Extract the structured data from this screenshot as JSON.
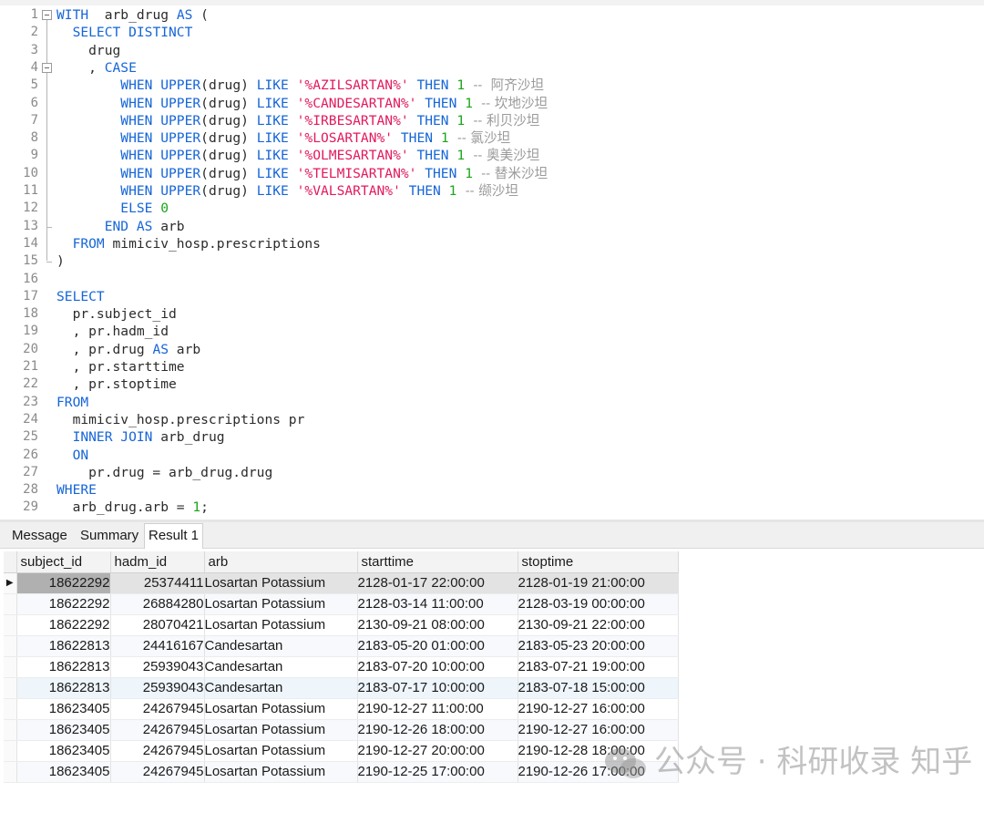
{
  "editor": {
    "lines": [
      {
        "n": "1",
        "segs": [
          [
            "kw",
            "WITH"
          ],
          [
            "",
            "  arb_drug "
          ],
          [
            "kw",
            "AS"
          ],
          [
            "",
            " ("
          ]
        ]
      },
      {
        "n": "2",
        "segs": [
          [
            "",
            "  "
          ],
          [
            "kw",
            "SELECT DISTINCT"
          ]
        ]
      },
      {
        "n": "3",
        "segs": [
          [
            "",
            "    drug"
          ]
        ]
      },
      {
        "n": "4",
        "segs": [
          [
            "",
            "    , "
          ],
          [
            "kw",
            "CASE"
          ]
        ]
      },
      {
        "n": "5",
        "segs": [
          [
            "",
            "        "
          ],
          [
            "kw",
            "WHEN UPPER"
          ],
          [
            "",
            "(drug) "
          ],
          [
            "kw",
            "LIKE"
          ],
          [
            "",
            " "
          ],
          [
            "str",
            "'%AZILSARTAN%'"
          ],
          [
            "",
            " "
          ],
          [
            "kw",
            "THEN"
          ],
          [
            "",
            " "
          ],
          [
            "num",
            "1"
          ],
          [
            "cmt",
            "  --  阿齐沙坦"
          ]
        ]
      },
      {
        "n": "6",
        "segs": [
          [
            "",
            "        "
          ],
          [
            "kw",
            "WHEN UPPER"
          ],
          [
            "",
            "(drug) "
          ],
          [
            "kw",
            "LIKE"
          ],
          [
            "",
            " "
          ],
          [
            "str",
            "'%CANDESARTAN%'"
          ],
          [
            "",
            " "
          ],
          [
            "kw",
            "THEN"
          ],
          [
            "",
            " "
          ],
          [
            "num",
            "1"
          ],
          [
            "cmt",
            "  -- 坎地沙坦"
          ]
        ]
      },
      {
        "n": "7",
        "segs": [
          [
            "",
            "        "
          ],
          [
            "kw",
            "WHEN UPPER"
          ],
          [
            "",
            "(drug) "
          ],
          [
            "kw",
            "LIKE"
          ],
          [
            "",
            " "
          ],
          [
            "str",
            "'%IRBESARTAN%'"
          ],
          [
            "",
            " "
          ],
          [
            "kw",
            "THEN"
          ],
          [
            "",
            " "
          ],
          [
            "num",
            "1"
          ],
          [
            "cmt",
            "  -- 利贝沙坦"
          ]
        ]
      },
      {
        "n": "8",
        "segs": [
          [
            "",
            "        "
          ],
          [
            "kw",
            "WHEN UPPER"
          ],
          [
            "",
            "(drug) "
          ],
          [
            "kw",
            "LIKE"
          ],
          [
            "",
            " "
          ],
          [
            "str",
            "'%LOSARTAN%'"
          ],
          [
            "",
            " "
          ],
          [
            "kw",
            "THEN"
          ],
          [
            "",
            " "
          ],
          [
            "num",
            "1"
          ],
          [
            "cmt",
            "  -- 氯沙坦"
          ]
        ]
      },
      {
        "n": "9",
        "segs": [
          [
            "",
            "        "
          ],
          [
            "kw",
            "WHEN UPPER"
          ],
          [
            "",
            "(drug) "
          ],
          [
            "kw",
            "LIKE"
          ],
          [
            "",
            " "
          ],
          [
            "str",
            "'%OLMESARTAN%'"
          ],
          [
            "",
            " "
          ],
          [
            "kw",
            "THEN"
          ],
          [
            "",
            " "
          ],
          [
            "num",
            "1"
          ],
          [
            "cmt",
            "  -- 奥美沙坦"
          ]
        ]
      },
      {
        "n": "10",
        "segs": [
          [
            "",
            "        "
          ],
          [
            "kw",
            "WHEN UPPER"
          ],
          [
            "",
            "(drug) "
          ],
          [
            "kw",
            "LIKE"
          ],
          [
            "",
            " "
          ],
          [
            "str",
            "'%TELMISARTAN%'"
          ],
          [
            "",
            " "
          ],
          [
            "kw",
            "THEN"
          ],
          [
            "",
            " "
          ],
          [
            "num",
            "1"
          ],
          [
            "cmt",
            "  -- 替米沙坦"
          ]
        ]
      },
      {
        "n": "11",
        "segs": [
          [
            "",
            "        "
          ],
          [
            "kw",
            "WHEN UPPER"
          ],
          [
            "",
            "(drug) "
          ],
          [
            "kw",
            "LIKE"
          ],
          [
            "",
            " "
          ],
          [
            "str",
            "'%VALSARTAN%'"
          ],
          [
            "",
            " "
          ],
          [
            "kw",
            "THEN"
          ],
          [
            "",
            " "
          ],
          [
            "num",
            "1"
          ],
          [
            "cmt",
            "  -- 缬沙坦"
          ]
        ]
      },
      {
        "n": "12",
        "segs": [
          [
            "",
            "        "
          ],
          [
            "kw",
            "ELSE"
          ],
          [
            "",
            " "
          ],
          [
            "num",
            "0"
          ]
        ]
      },
      {
        "n": "13",
        "segs": [
          [
            "",
            "      "
          ],
          [
            "kw",
            "END AS"
          ],
          [
            "",
            " arb"
          ]
        ]
      },
      {
        "n": "14",
        "segs": [
          [
            "",
            "  "
          ],
          [
            "kw",
            "FROM"
          ],
          [
            "",
            " mimiciv_hosp.prescriptions"
          ]
        ]
      },
      {
        "n": "15",
        "segs": [
          [
            "",
            ")"
          ]
        ]
      },
      {
        "n": "16",
        "segs": []
      },
      {
        "n": "17",
        "segs": [
          [
            "kw",
            "SELECT"
          ]
        ]
      },
      {
        "n": "18",
        "segs": [
          [
            "",
            "  pr.subject_id"
          ]
        ]
      },
      {
        "n": "19",
        "segs": [
          [
            "",
            "  , pr.hadm_id"
          ]
        ]
      },
      {
        "n": "20",
        "segs": [
          [
            "",
            "  , pr.drug "
          ],
          [
            "kw",
            "AS"
          ],
          [
            "",
            " arb"
          ]
        ]
      },
      {
        "n": "21",
        "segs": [
          [
            "",
            "  , pr.starttime"
          ]
        ]
      },
      {
        "n": "22",
        "segs": [
          [
            "",
            "  , pr.stoptime"
          ]
        ]
      },
      {
        "n": "23",
        "segs": [
          [
            "kw",
            "FROM"
          ]
        ]
      },
      {
        "n": "24",
        "segs": [
          [
            "",
            "  mimiciv_hosp.prescriptions pr"
          ]
        ]
      },
      {
        "n": "25",
        "segs": [
          [
            "",
            "  "
          ],
          [
            "kw",
            "INNER JOIN"
          ],
          [
            "",
            " arb_drug"
          ]
        ]
      },
      {
        "n": "26",
        "segs": [
          [
            "",
            "  "
          ],
          [
            "kw",
            "ON"
          ]
        ]
      },
      {
        "n": "27",
        "segs": [
          [
            "",
            "    pr.drug = arb_drug.drug"
          ]
        ]
      },
      {
        "n": "28",
        "segs": [
          [
            "kw",
            "WHERE"
          ]
        ]
      },
      {
        "n": "29",
        "segs": [
          [
            "",
            "  arb_drug.arb = "
          ],
          [
            "num",
            "1"
          ],
          [
            "",
            ";"
          ]
        ]
      }
    ]
  },
  "tabs": [
    {
      "label": "Message",
      "active": false
    },
    {
      "label": "Summary",
      "active": false
    },
    {
      "label": "Result 1",
      "active": true
    }
  ],
  "grid": {
    "columns": [
      "subject_id",
      "hadm_id",
      "arb",
      "starttime",
      "stoptime"
    ],
    "rows": [
      [
        "18622292",
        "25374411",
        "Losartan Potassium",
        "2128-01-17 22:00:00",
        "2128-01-19 21:00:00"
      ],
      [
        "18622292",
        "26884280",
        "Losartan Potassium",
        "2128-03-14 11:00:00",
        "2128-03-19 00:00:00"
      ],
      [
        "18622292",
        "28070421",
        "Losartan Potassium",
        "2130-09-21 08:00:00",
        "2130-09-21 22:00:00"
      ],
      [
        "18622813",
        "24416167",
        "Candesartan",
        "2183-05-20 01:00:00",
        "2183-05-23 20:00:00"
      ],
      [
        "18622813",
        "25939043",
        "Candesartan",
        "2183-07-20 10:00:00",
        "2183-07-21 19:00:00"
      ],
      [
        "18622813",
        "25939043",
        "Candesartan",
        "2183-07-17 10:00:00",
        "2183-07-18 15:00:00"
      ],
      [
        "18623405",
        "24267945",
        "Losartan Potassium",
        "2190-12-27 11:00:00",
        "2190-12-27 16:00:00"
      ],
      [
        "18623405",
        "24267945",
        "Losartan Potassium",
        "2190-12-26 18:00:00",
        "2190-12-27 16:00:00"
      ],
      [
        "18623405",
        "24267945",
        "Losartan Potassium",
        "2190-12-27 20:00:00",
        "2190-12-28 18:00:00"
      ],
      [
        "18623405",
        "24267945",
        "Losartan Potassium",
        "2190-12-25 17:00:00",
        "2190-12-26 17:00:00"
      ]
    ],
    "selected_row": 0,
    "hover_row": 5,
    "row_indicator": "▶"
  },
  "watermark": {
    "text": "公众号 · 科研收录 知乎 @白鲸鱼"
  },
  "colors": {
    "keyword": "#1565d8",
    "string": "#e2195b",
    "number": "#19a519",
    "comment": "#9a9a9a"
  }
}
